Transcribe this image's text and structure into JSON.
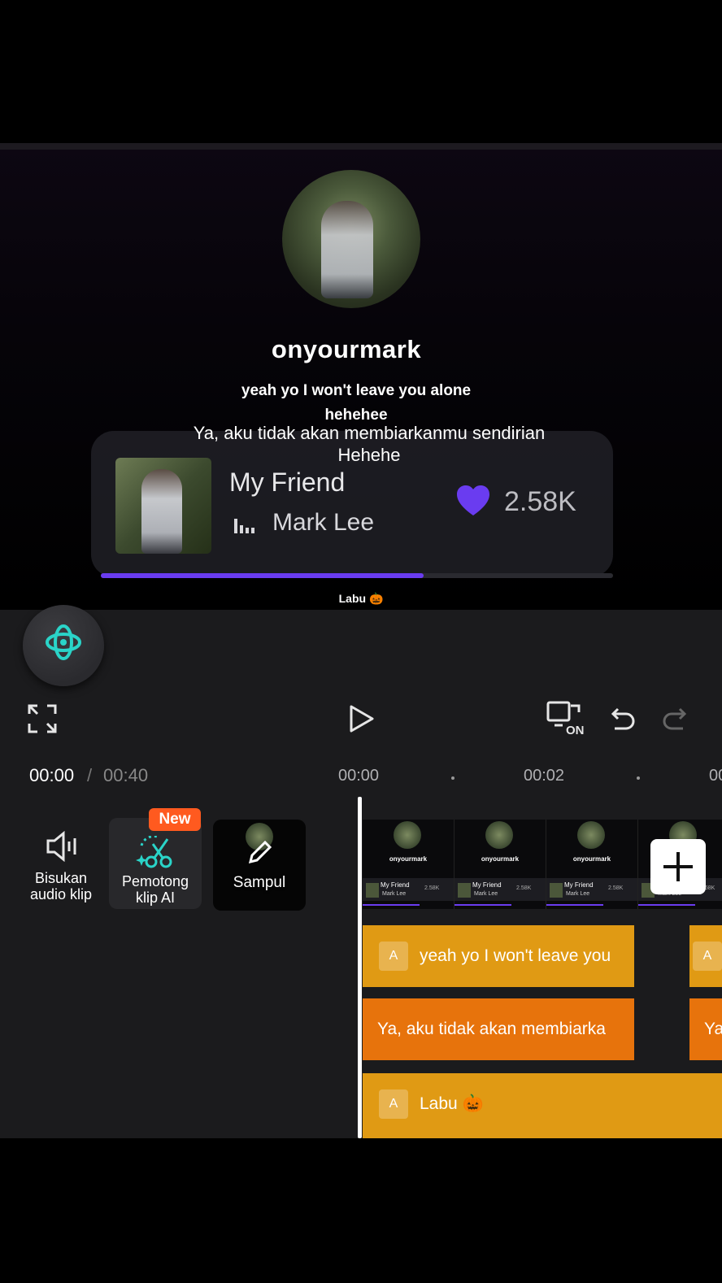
{
  "preview": {
    "username": "onyourmark",
    "lyric_en": "yeah yo I won't leave you alone hehehee",
    "lyric_id": "Ya, aku tidak akan membiarkanmu sendirian Hehehe",
    "song_title": "My Friend",
    "artist": "Mark Lee",
    "likes": "2.58K",
    "song_progress": 0.63,
    "caption": "Labu 🎃",
    "accent_color": "#6a3cf0"
  },
  "controls": {
    "fullscreen_icon": "expand-icon",
    "play_icon": "play-icon",
    "mode_label": "ON",
    "undo_icon": "undo-icon",
    "redo_icon": "redo-icon"
  },
  "timeline": {
    "current_time": "00:00",
    "separator": "/",
    "total_time": "00:40",
    "ruler": [
      "00:00",
      "00:02",
      "00"
    ]
  },
  "tools": {
    "mute_label_1": "Bisukan",
    "mute_label_2": "audio klip",
    "ai_cut_label_1": "Pemotong",
    "ai_cut_label_2": "klip AI",
    "new_badge": "New",
    "cover_label": "Sampul"
  },
  "track": {
    "frame_name": "onyourmark",
    "frame_song": "My Friend",
    "frame_artist": "Mark Lee",
    "frame_likes": "2.58K"
  },
  "clips": {
    "text1": "yeah yo I won't leave you",
    "text2": "Ya, aku tidak akan membiarka",
    "text2_next": "Ya",
    "text3": "Labu 🎃"
  }
}
